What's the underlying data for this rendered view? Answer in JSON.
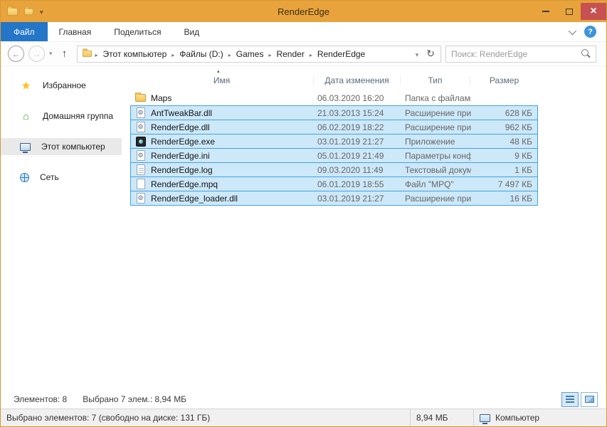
{
  "theme": {
    "titlebar": "#E8A33C",
    "window_border": "#D8982F",
    "file_tab": "#2376C8",
    "selection_fill": "#CDE8F9",
    "selection_border": "#41A3DC",
    "close_button": "#C75050"
  },
  "window": {
    "title": "RenderEdge"
  },
  "ribbon": {
    "tabs": [
      {
        "label": "Файл",
        "active": true
      },
      {
        "label": "Главная",
        "active": false
      },
      {
        "label": "Поделиться",
        "active": false
      },
      {
        "label": "Вид",
        "active": false
      }
    ]
  },
  "nav": {
    "breadcrumb": [
      "Этот компьютер",
      "Файлы (D:)",
      "Games",
      "Render",
      "RenderEdge"
    ],
    "search_placeholder": "Поиск: RenderEdge"
  },
  "sidebar": {
    "items": [
      {
        "label": "Избранное",
        "icon": "star",
        "selected": false
      },
      {
        "label": "Домашняя группа",
        "icon": "homegroup",
        "selected": false
      },
      {
        "label": "Этот компьютер",
        "icon": "computer",
        "selected": true
      },
      {
        "label": "Сеть",
        "icon": "network",
        "selected": false
      }
    ]
  },
  "filelist": {
    "columns": [
      "Имя",
      "Дата изменения",
      "Тип",
      "Размер"
    ],
    "sort_column": "Имя",
    "sort_glyph": "▴",
    "rows": [
      {
        "name": "Maps",
        "date": "06.03.2020 16:20",
        "type": "Папка с файлами",
        "size": "",
        "icon": "folder",
        "selected": false
      },
      {
        "name": "AntTweakBar.dll",
        "date": "21.03.2013 15:24",
        "type": "Расширение при...",
        "size": "628 КБ",
        "icon": "dll",
        "selected": true
      },
      {
        "name": "RenderEdge.dll",
        "date": "06.02.2019 18:22",
        "type": "Расширение при...",
        "size": "962 КБ",
        "icon": "dll",
        "selected": true
      },
      {
        "name": "RenderEdge.exe",
        "date": "03.01.2019 21:27",
        "type": "Приложение",
        "size": "48 КБ",
        "icon": "exe",
        "selected": true
      },
      {
        "name": "RenderEdge.ini",
        "date": "05.01.2019 21:49",
        "type": "Параметры конф...",
        "size": "9 КБ",
        "icon": "ini",
        "selected": true
      },
      {
        "name": "RenderEdge.log",
        "date": "09.03.2020 11:49",
        "type": "Текстовый докум...",
        "size": "1 КБ",
        "icon": "log",
        "selected": true
      },
      {
        "name": "RenderEdge.mpq",
        "date": "06.01.2019 18:55",
        "type": "Файл \"MPQ\"",
        "size": "7 497 КБ",
        "icon": "file",
        "selected": true
      },
      {
        "name": "RenderEdge_loader.dll",
        "date": "03.01.2019 21:27",
        "type": "Расширение при...",
        "size": "16 КБ",
        "icon": "dll",
        "selected": true
      }
    ]
  },
  "statusbar": {
    "items_total": "Элементов: 8",
    "items_selected": "Выбрано 7 элем.: 8,94 МБ"
  },
  "bottombar": {
    "selection_info": "Выбрано элементов: 7 (свободно на диске: 131 ГБ)",
    "total_size": "8,94 МБ",
    "location": "Компьютер"
  }
}
